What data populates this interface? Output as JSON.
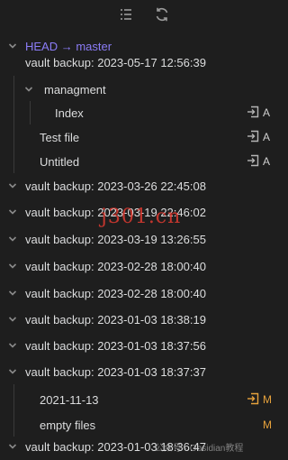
{
  "toolbar": {
    "list_icon": "list-tree-icon",
    "refresh_icon": "refresh-icon"
  },
  "history": {
    "head": "HEAD → master",
    "commits": [
      {
        "label": "vault backup: 2023-05-17 12:56:39"
      },
      {
        "label": "vault backup: 2023-03-26 22:45:08"
      },
      {
        "label": "vault backup: 2023-03-19 22:46:02"
      },
      {
        "label": "vault backup: 2023-03-19 13:26:55"
      },
      {
        "label": "vault backup: 2023-02-28 18:00:40"
      },
      {
        "label": "vault backup: 2023-02-28 18:00:40"
      },
      {
        "label": "vault backup: 2023-01-03 18:38:19"
      },
      {
        "label": "vault backup: 2023-01-03 18:37:56"
      },
      {
        "label": "vault backup: 2023-01-03 18:37:37"
      },
      {
        "label": "vault backup: 2023-01-03 18:36:47"
      }
    ],
    "first_commit_files": {
      "folder": "managment",
      "folder_file": {
        "name": "Index",
        "status": "A"
      },
      "files": [
        {
          "name": "Test file",
          "status": "A"
        },
        {
          "name": "Untitled",
          "status": "A"
        }
      ]
    },
    "ninth_commit_files": [
      {
        "name": "2021-11-13",
        "status": "M"
      },
      {
        "name": "empty files",
        "status": "M"
      }
    ]
  },
  "colors": {
    "background": "#1e1e1e",
    "head_accent": "#8b7cf6",
    "added_status": "#cfcfcf",
    "modified_status": "#e8a33c"
  },
  "watermark": {
    "center": "j301.cn",
    "bottom": "公众号 · Obsidian教程"
  }
}
